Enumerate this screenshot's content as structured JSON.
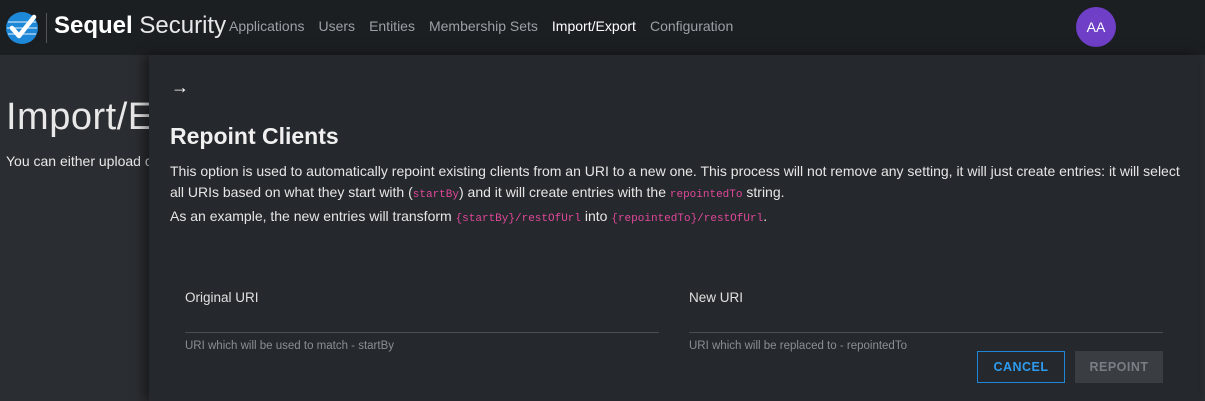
{
  "header": {
    "brand_bold": "Sequel",
    "brand_light": "Security",
    "logo_icon": "checkmark-globe-icon",
    "nav": [
      {
        "label": "Applications",
        "active": false
      },
      {
        "label": "Users",
        "active": false
      },
      {
        "label": "Entities",
        "active": false
      },
      {
        "label": "Membership Sets",
        "active": false
      },
      {
        "label": "Import/Export",
        "active": true
      },
      {
        "label": "Configuration",
        "active": false
      }
    ],
    "avatar_initials": "AA",
    "avatar_color": "#6f3fc8"
  },
  "background_page": {
    "title": "Import/Ex",
    "text": "You can either upload c"
  },
  "drawer": {
    "close_icon": "arrow-right-icon",
    "close_glyph": "→",
    "title": "Repoint Clients",
    "desc_part1": "This option is used to automatically repoint existing clients from an URI to a new one. This process will not remove any setting, it will just create entries: it will select all URIs based on what they start with (",
    "code_startBy": "startBy",
    "desc_part2": ") and it will create entries with the ",
    "code_repointedTo": "repointedTo",
    "desc_part3": " string.",
    "desc_example_1": "As an example, the new entries will transform ",
    "code_example_from": "{startBy}/restOfUrl",
    "desc_example_2": " into ",
    "code_example_to": "{repointedTo}/restOfUrl",
    "desc_example_3": ".",
    "original_uri": {
      "label": "Original URI",
      "value": "",
      "hint": "URI which will be used to match - startBy"
    },
    "new_uri": {
      "label": "New URI",
      "value": "",
      "hint": "URI which will be replaced to - repointedTo"
    },
    "cancel_label": "CANCEL",
    "repoint_label": "REPOINT",
    "accent_color": "#1e88d8",
    "code_color": "#e0489a"
  }
}
